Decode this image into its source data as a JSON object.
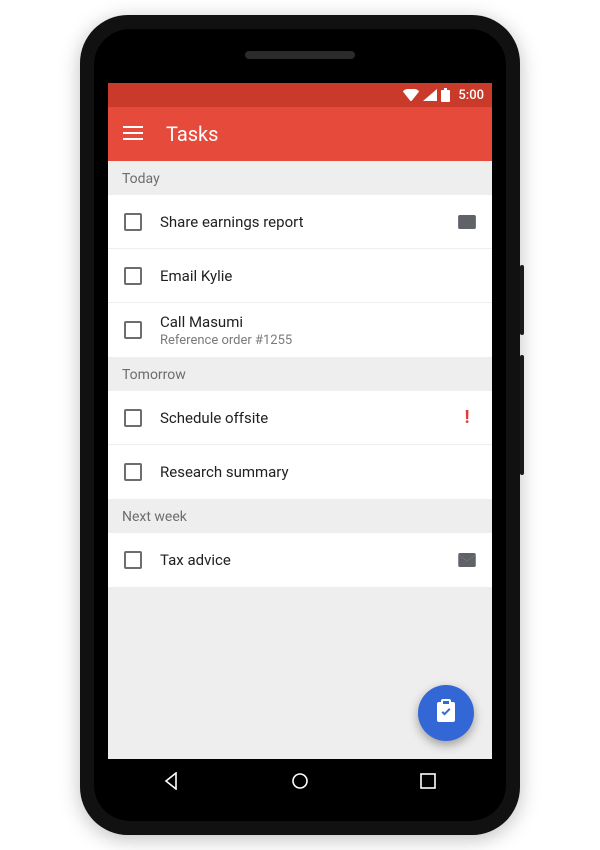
{
  "status": {
    "time": "5:00"
  },
  "header": {
    "title": "Tasks"
  },
  "sections": [
    {
      "label": "Today",
      "tasks": [
        {
          "title": "Share earnings report",
          "subtitle": "",
          "icon": "mail"
        },
        {
          "title": "Email Kylie",
          "subtitle": "",
          "icon": ""
        },
        {
          "title": "Call Masumi",
          "subtitle": "Reference order #1255",
          "icon": ""
        }
      ]
    },
    {
      "label": "Tomorrow",
      "tasks": [
        {
          "title": "Schedule offsite",
          "subtitle": "",
          "icon": "priority"
        },
        {
          "title": "Research summary",
          "subtitle": "",
          "icon": ""
        }
      ]
    },
    {
      "label": "Next week",
      "tasks": [
        {
          "title": "Tax advice",
          "subtitle": "",
          "icon": "mail"
        }
      ]
    }
  ],
  "colors": {
    "statusbar": "#c93a2b",
    "appbar": "#e64a3b",
    "fab": "#3367d6",
    "priority": "#e53935"
  }
}
